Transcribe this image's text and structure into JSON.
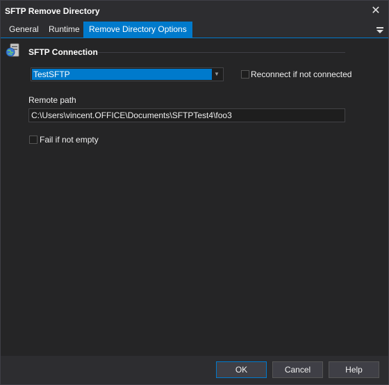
{
  "window": {
    "title": "SFTP Remove Directory"
  },
  "tabs": [
    {
      "label": "General"
    },
    {
      "label": "Runtime"
    },
    {
      "label": "Remove Directory Options"
    }
  ],
  "section": {
    "title": "SFTP Connection"
  },
  "connection": {
    "selected": "TestSFTP"
  },
  "reconnect": {
    "label": "Reconnect if not connected",
    "checked": false
  },
  "remote_path": {
    "label": "Remote path",
    "value": "C:\\Users\\vincent.OFFICE\\Documents\\SFTPTest4\\foo3"
  },
  "fail_if_not_empty": {
    "label": "Fail if not empty",
    "checked": false
  },
  "buttons": {
    "ok": "OK",
    "cancel": "Cancel",
    "help": "Help"
  },
  "colors": {
    "accent": "#007acc",
    "background": "#252526"
  },
  "icons": {
    "close": "close-icon",
    "menu": "tab-menu-icon",
    "section": "sftp-connection-icon",
    "dropdown": "chevron-down-icon"
  }
}
